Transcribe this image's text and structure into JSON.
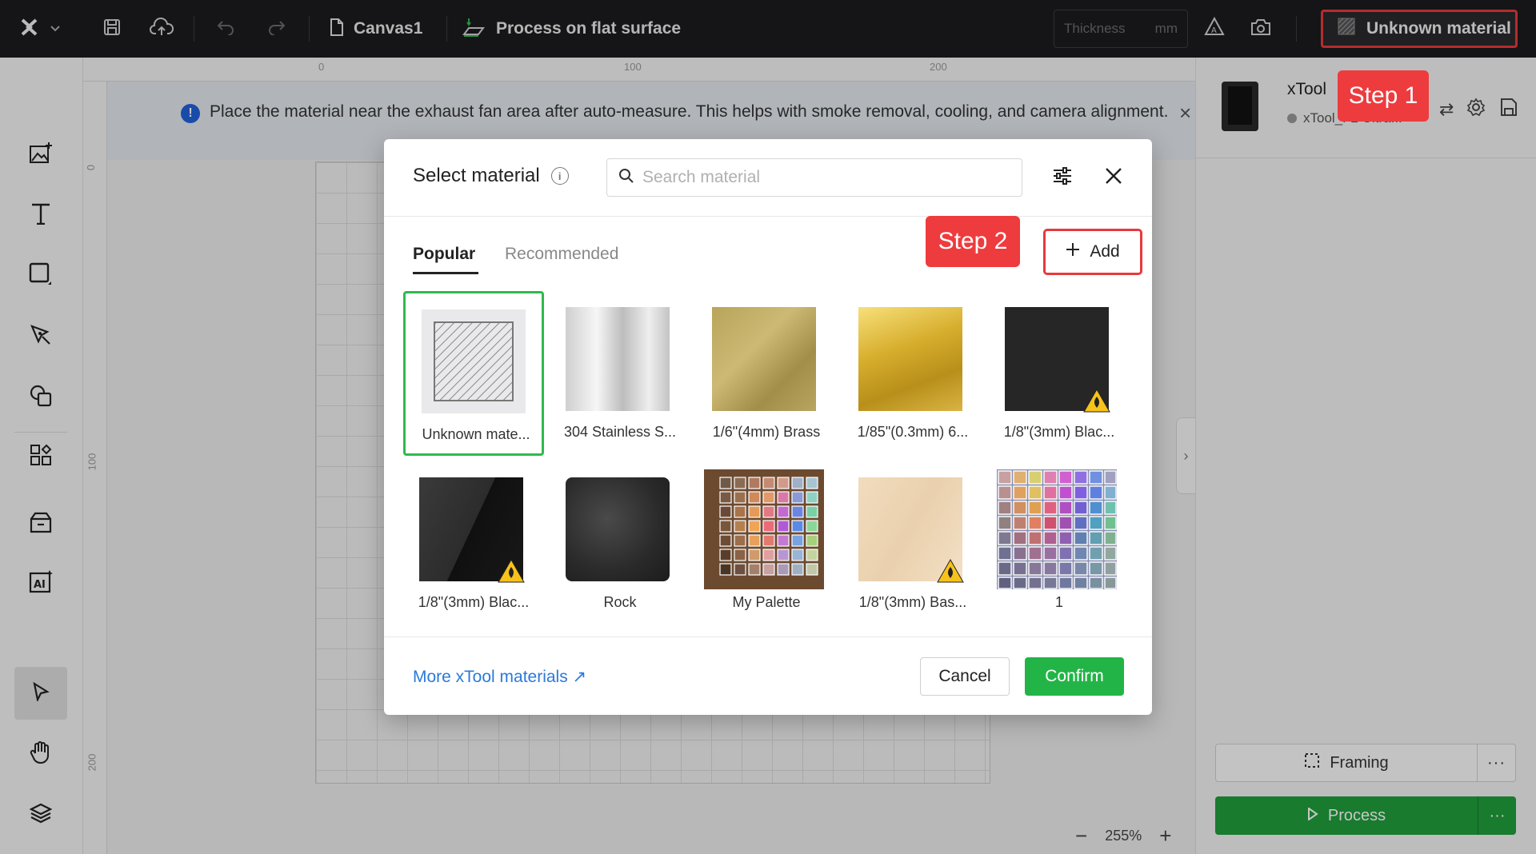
{
  "topbar": {
    "canvas_name": "Canvas1",
    "process_mode": "Process on flat surface",
    "thickness_placeholder": "Thickness",
    "thickness_unit": "mm",
    "material_label": "Unknown material"
  },
  "ruler": {
    "top_ticks": [
      "0",
      "100",
      "200"
    ],
    "left_ticks": [
      "0",
      "100",
      "200"
    ]
  },
  "banner": {
    "text": "Place the material near the exhaust fan area after auto-measure. This helps with smoke removal, cooling, and camera alignment."
  },
  "zoom": {
    "level": "255%"
  },
  "device": {
    "name": "xTool",
    "status": "xTool_F2 Ultra..."
  },
  "steps": {
    "step1": "Step 1",
    "step2": "Step 2"
  },
  "right_actions": {
    "framing": "Framing",
    "process": "Process",
    "more": "···"
  },
  "modal": {
    "title": "Select material",
    "search_placeholder": "Search material",
    "tabs": [
      "Popular",
      "Recommended"
    ],
    "add_label": "Add",
    "materials": [
      {
        "label": "Unknown mate...",
        "selected": true,
        "flammable": false
      },
      {
        "label": "304 Stainless S...",
        "selected": false,
        "flammable": false
      },
      {
        "label": "1/6\"(4mm) Brass",
        "selected": false,
        "flammable": false
      },
      {
        "label": "1/85\"(0.3mm) 6...",
        "selected": false,
        "flammable": false
      },
      {
        "label": "1/8\"(3mm) Blac...",
        "selected": false,
        "flammable": true
      },
      {
        "label": "1/8\"(3mm) Blac...",
        "selected": false,
        "flammable": true
      },
      {
        "label": "Rock",
        "selected": false,
        "flammable": false
      },
      {
        "label": "My Palette",
        "selected": false,
        "flammable": false
      },
      {
        "label": "1/8\"(3mm) Bas...",
        "selected": false,
        "flammable": true
      },
      {
        "label": "1",
        "selected": false,
        "flammable": false
      }
    ],
    "more_link": "More xTool materials ↗",
    "cancel": "Cancel",
    "confirm": "Confirm"
  },
  "colors": {
    "accent_green": "#22b447",
    "highlight_red": "#e8393b",
    "link_blue": "#2b7ad8"
  }
}
